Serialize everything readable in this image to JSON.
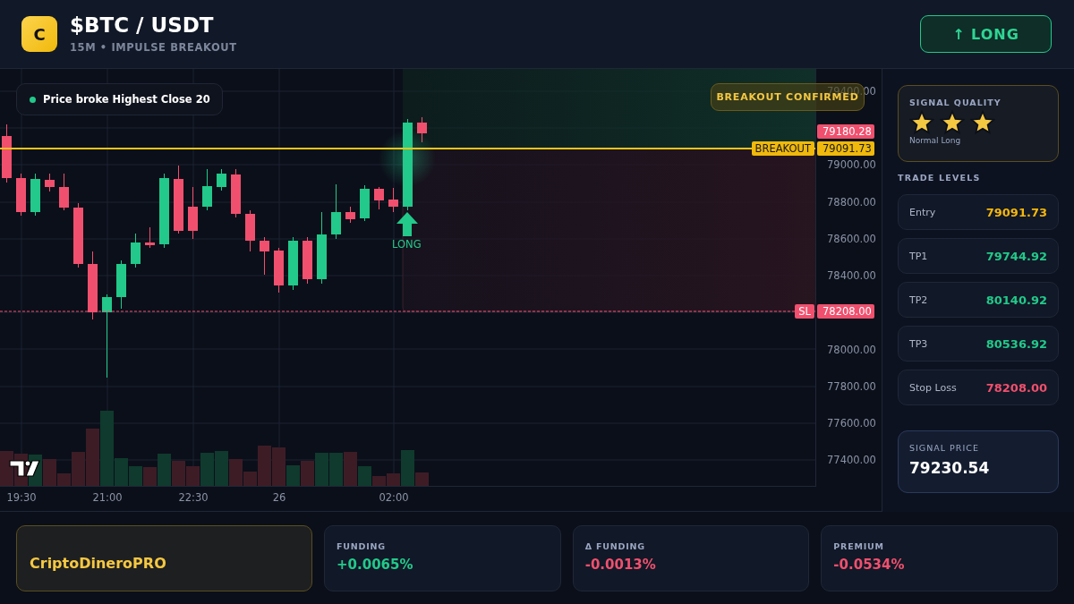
{
  "header": {
    "logo": "C",
    "title": "$BTC / USDT",
    "subtitle": "15M • IMPULSE BREAKOUT",
    "action_button": "↑ LONG"
  },
  "chart": {
    "notice": "Price broke Highest Close 20",
    "status_badge": "BREAKOUT CONFIRMED",
    "signal_marker": "LONG",
    "price_ticks": [
      "79400.00",
      "79000.00",
      "78800.00",
      "78600.00",
      "78400.00",
      "78000.00",
      "77800.00",
      "77600.00",
      "77400.00"
    ],
    "time_ticks": [
      "19:30",
      "21:00",
      "22:30",
      "26",
      "02:00"
    ],
    "price_tags": [
      {
        "kind": "last",
        "value": "79180.28"
      },
      {
        "kind": "breakout",
        "label": "BREAKOUT",
        "value": "79091.73"
      },
      {
        "kind": "stop",
        "label": "SL",
        "value": "78208.00"
      }
    ]
  },
  "signal_quality": {
    "title": "SIGNAL QUALITY",
    "stars": 3,
    "caption": "Normal Long"
  },
  "trade_levels": {
    "title": "TRADE LEVELS",
    "rows": [
      {
        "kind": "entry",
        "label": "Entry",
        "value": "79091.73"
      },
      {
        "kind": "target",
        "label": "TP1",
        "value": "79744.92"
      },
      {
        "kind": "target",
        "label": "TP2",
        "value": "80140.92"
      },
      {
        "kind": "target",
        "label": "TP3",
        "value": "80536.92"
      },
      {
        "kind": "stop",
        "label": "Stop Loss",
        "value": "78208.00"
      }
    ]
  },
  "signal_price": {
    "label": "SIGNAL PRICE",
    "value": "79230.54"
  },
  "footer": {
    "brand": "CriptoDineroPRO",
    "metrics": [
      {
        "kind": "positive",
        "label": "FUNDING",
        "value": "+0.0065%"
      },
      {
        "kind": "negative",
        "label": "Δ FUNDING",
        "value": "-0.0013%"
      },
      {
        "kind": "negative",
        "label": "PREMIUM",
        "value": "-0.0534%"
      }
    ]
  }
}
